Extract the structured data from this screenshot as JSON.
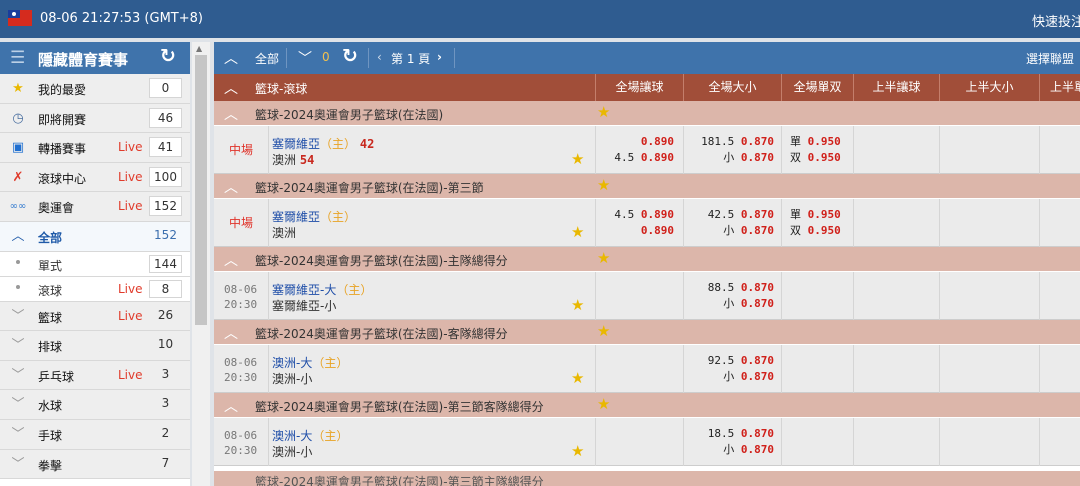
{
  "topbar": {
    "datetime": "08-06 21:27:53 (GMT+8)",
    "quick_bet": "快速投注"
  },
  "sidebar": {
    "title": "隱藏體育賽事",
    "items": [
      {
        "label": "我的最愛",
        "live": "",
        "count": "0",
        "icon": "star-icon"
      },
      {
        "label": "即將開賽",
        "live": "",
        "count": "46",
        "icon": "clock-icon"
      },
      {
        "label": "轉播賽事",
        "live": "Live",
        "count": "41",
        "icon": "tv-icon"
      },
      {
        "label": "滾球中心",
        "live": "Live",
        "count": "100",
        "icon": "runner-icon"
      },
      {
        "label": "奧運會",
        "live": "Live",
        "count": "152",
        "icon": "olympic-rings-icon"
      }
    ],
    "all": {
      "label": "全部",
      "count": "152"
    },
    "subs": [
      {
        "label": "單式",
        "live": "",
        "count": "144"
      },
      {
        "label": "滾球",
        "live": "Live",
        "count": "8"
      }
    ],
    "sports": [
      {
        "label": "籃球",
        "live": "Live",
        "count": "26"
      },
      {
        "label": "排球",
        "live": "",
        "count": "10"
      },
      {
        "label": "乒乓球",
        "live": "Live",
        "count": "3"
      },
      {
        "label": "水球",
        "live": "",
        "count": "3"
      },
      {
        "label": "手球",
        "live": "",
        "count": "2"
      },
      {
        "label": "拳擊",
        "live": "",
        "count": "7"
      }
    ]
  },
  "toolbar": {
    "all": "全部",
    "count": "0",
    "page": "第 1 頁",
    "select_league": "選擇聯盟"
  },
  "header": {
    "sport": "籃球-滾球",
    "cols": [
      "全場讓球",
      "全場大小",
      "全場單双",
      "上半讓球",
      "上半大小",
      "上半單"
    ]
  },
  "leagues": [
    {
      "name": "籃球-2024奧運會男子籃球(在法國)",
      "match": {
        "stage": "中場",
        "date": "",
        "time": "",
        "team1": "塞爾維亞",
        "home": "（主）",
        "score1": "42",
        "team2": "澳洲",
        "score2": "54",
        "hcp_line": [
          "",
          ""
        ],
        "hcp_odds": [
          "0.890",
          "0.890"
        ],
        "hcp_pre": "4.5",
        "ou_line": [
          "181.5",
          "小"
        ],
        "ou_odds": [
          "0.870",
          "0.870"
        ],
        "oe_label": [
          "單",
          "双"
        ],
        "oe_odds": [
          "0.950",
          "0.950"
        ]
      }
    },
    {
      "name": "籃球-2024奧運會男子籃球(在法國)-第三節",
      "match": {
        "stage": "中場",
        "date": "",
        "time": "",
        "team1": "塞爾維亞",
        "home": "（主）",
        "score1": "",
        "team2": "澳洲",
        "score2": "",
        "hcp_line": [
          "4.5",
          ""
        ],
        "hcp_odds": [
          "0.890",
          "0.890"
        ],
        "hcp_pre": "",
        "ou_line": [
          "42.5",
          "小"
        ],
        "ou_odds": [
          "0.870",
          "0.870"
        ],
        "oe_label": [
          "單",
          "双"
        ],
        "oe_odds": [
          "0.950",
          "0.950"
        ]
      }
    },
    {
      "name": "籃球-2024奧運會男子籃球(在法國)-主隊總得分",
      "match": {
        "stage": "",
        "date": "08-06",
        "time": "20:30",
        "team1": "塞爾維亞-大",
        "home": "（主）",
        "score1": "",
        "team2": "塞爾維亞-小",
        "score2": "",
        "hcp_line": [
          "",
          ""
        ],
        "hcp_odds": [
          "",
          ""
        ],
        "hcp_pre": "",
        "ou_line": [
          "88.5",
          "小"
        ],
        "ou_odds": [
          "0.870",
          "0.870"
        ],
        "oe_label": [
          "",
          ""
        ],
        "oe_odds": [
          "",
          ""
        ]
      }
    },
    {
      "name": "籃球-2024奧運會男子籃球(在法國)-客隊總得分",
      "match": {
        "stage": "",
        "date": "08-06",
        "time": "20:30",
        "team1": "澳洲-大",
        "home": "（主）",
        "score1": "",
        "team2": "澳洲-小",
        "score2": "",
        "hcp_line": [
          "",
          ""
        ],
        "hcp_odds": [
          "",
          ""
        ],
        "hcp_pre": "",
        "ou_line": [
          "92.5",
          "小"
        ],
        "ou_odds": [
          "0.870",
          "0.870"
        ],
        "oe_label": [
          "",
          ""
        ],
        "oe_odds": [
          "",
          ""
        ]
      }
    },
    {
      "name": "籃球-2024奧運會男子籃球(在法國)-第三節客隊總得分",
      "match": {
        "stage": "",
        "date": "08-06",
        "time": "20:30",
        "team1": "澳洲-大",
        "home": "（主）",
        "score1": "",
        "team2": "澳洲-小",
        "score2": "",
        "hcp_line": [
          "",
          ""
        ],
        "hcp_odds": [
          "",
          ""
        ],
        "hcp_pre": "",
        "ou_line": [
          "18.5",
          "小"
        ],
        "ou_odds": [
          "0.870",
          "0.870"
        ],
        "oe_label": [
          "",
          ""
        ],
        "oe_odds": [
          "",
          ""
        ]
      }
    }
  ],
  "partial_league": "籃球-2024奧運會男子籃球(在法國)-第三節主隊總得分",
  "colors": {
    "topbar": "#2f5c90",
    "panel_header": "#3f73ab",
    "column_header": "#a14e39",
    "league_row": "#dcb6aa",
    "odds": "#d0201a",
    "live": "#e03b2b"
  }
}
